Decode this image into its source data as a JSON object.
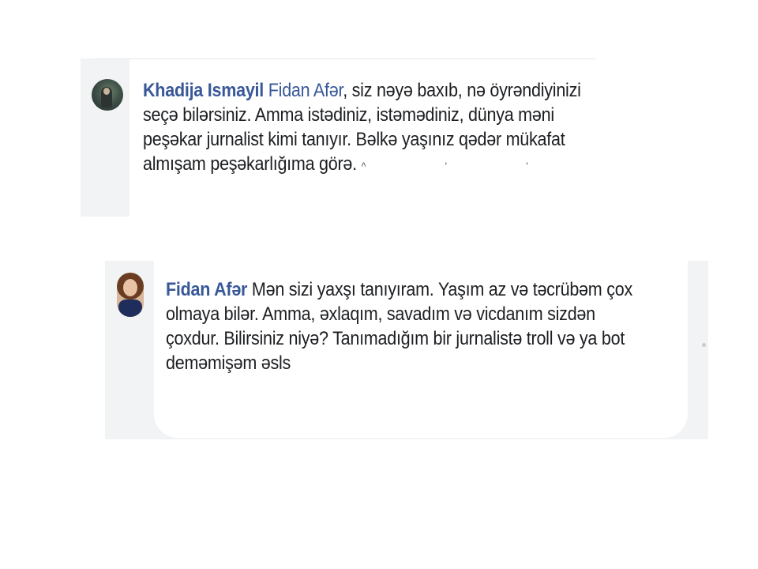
{
  "comment": {
    "author": "Khadija Ismayil",
    "mention": "Fidan Afər",
    "text": ", siz nəyə baxıb, nə öyrəndiyinizi seçə bilərsiniz. Amma istədiniz, istəmədiniz, dünya məni peşəkar jurnalist kimi tanıyır. Bəlkə yaşınız qədər mükafat almışam peşəkarlığıma görə.",
    "trailing_marks": "^ ' '",
    "avatar_icon": "profile-photo-icon"
  },
  "reply": {
    "author": "Fidan Afər",
    "text": "Mən sizi yaxşı tanıyıram. Yaşım az və təcrübəm çox olmaya bilər. Amma, əxlaqım, savadım və vicdanım sizdən çoxdur. Bilirsiniz niyə? Tanımadığım bir jurnalistə troll və ya bot deməmişəm əsls",
    "avatar_icon": "profile-photo-icon"
  },
  "colors": {
    "author_link": "#385898",
    "body_text": "#1c1e21",
    "panel_background": "#f2f3f5",
    "bubble_background": "#ffffff"
  }
}
